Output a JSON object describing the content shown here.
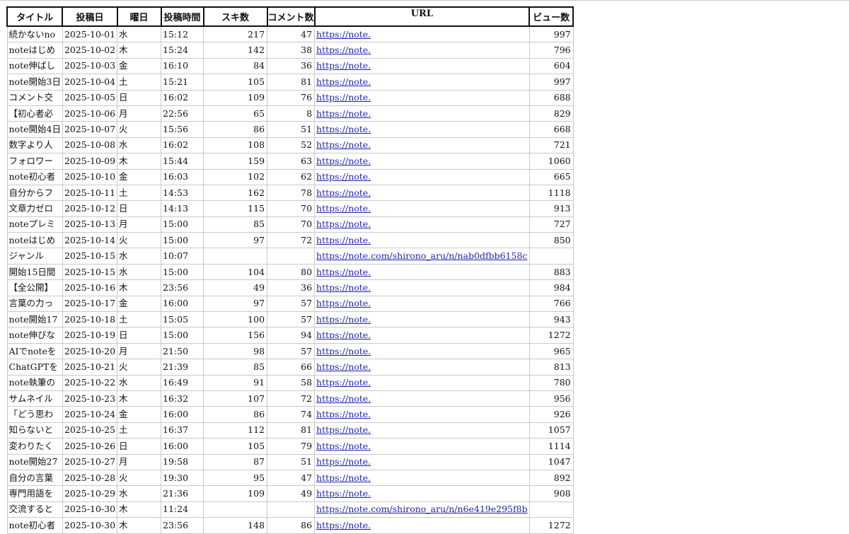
{
  "headers": {
    "title": "タイトル",
    "date": "投稿日",
    "weekday": "曜日",
    "time": "投稿時間",
    "likes": "スキ数",
    "comments": "コメント数",
    "url": "URL",
    "views": "ビュー数"
  },
  "rows": [
    {
      "title": "続かないno",
      "date": "2025-10-01",
      "weekday": "水",
      "time": "15:12",
      "likes": "217",
      "comments": "47",
      "url": "https://note.",
      "views": "997"
    },
    {
      "title": "noteはじめ",
      "date": "2025-10-02",
      "weekday": "木",
      "time": "15:24",
      "likes": "142",
      "comments": "38",
      "url": "https://note.",
      "views": "796"
    },
    {
      "title": "note伸ばし",
      "date": "2025-10-03",
      "weekday": "金",
      "time": "16:10",
      "likes": "84",
      "comments": "36",
      "url": "https://note.",
      "views": "604"
    },
    {
      "title": "note開始3日",
      "date": "2025-10-04",
      "weekday": "土",
      "time": "15:21",
      "likes": "105",
      "comments": "81",
      "url": "https://note.",
      "views": "997"
    },
    {
      "title": "コメント交",
      "date": "2025-10-05",
      "weekday": "日",
      "time": "16:02",
      "likes": "109",
      "comments": "76",
      "url": "https://note.",
      "views": "688"
    },
    {
      "title": "【初心者必",
      "date": "2025-10-06",
      "weekday": "月",
      "time": "22:56",
      "likes": "65",
      "comments": "8",
      "url": "https://note.",
      "views": "829"
    },
    {
      "title": "note開始4日",
      "date": "2025-10-07",
      "weekday": "火",
      "time": "15:56",
      "likes": "86",
      "comments": "51",
      "url": "https://note.",
      "views": "668"
    },
    {
      "title": "数字より人",
      "date": "2025-10-08",
      "weekday": "水",
      "time": "16:02",
      "likes": "108",
      "comments": "52",
      "url": "https://note.",
      "views": "721"
    },
    {
      "title": "フォロワー",
      "date": "2025-10-09",
      "weekday": "木",
      "time": "15:44",
      "likes": "159",
      "comments": "63",
      "url": "https://note.",
      "views": "1060"
    },
    {
      "title": "note初心者",
      "date": "2025-10-10",
      "weekday": "金",
      "time": "16:03",
      "likes": "102",
      "comments": "62",
      "url": "https://note.",
      "views": "665"
    },
    {
      "title": "自分からフ",
      "date": "2025-10-11",
      "weekday": "土",
      "time": "14:53",
      "likes": "162",
      "comments": "78",
      "url": "https://note.",
      "views": "1118"
    },
    {
      "title": "文章力ゼロ",
      "date": "2025-10-12",
      "weekday": "日",
      "time": "14:13",
      "likes": "115",
      "comments": "70",
      "url": "https://note.",
      "views": "913"
    },
    {
      "title": "noteプレミ",
      "date": "2025-10-13",
      "weekday": "月",
      "time": "15:00",
      "likes": "85",
      "comments": "70",
      "url": "https://note.",
      "views": "727"
    },
    {
      "title": "noteはじめ",
      "date": "2025-10-14",
      "weekday": "火",
      "time": "15:00",
      "likes": "97",
      "comments": "72",
      "url": "https://note.",
      "views": "850"
    },
    {
      "title": "ジャンル",
      "date": "2025-10-15",
      "weekday": "水",
      "time": "10:07",
      "likes": "",
      "comments": "",
      "url": "https://note.com/shirono_aru/n/nab0dfbb6158c",
      "views": "",
      "full": true
    },
    {
      "title": "開始15日間",
      "date": "2025-10-15",
      "weekday": "水",
      "time": "15:00",
      "likes": "104",
      "comments": "80",
      "url": "https://note.",
      "views": "883"
    },
    {
      "title": "【全公開】",
      "date": "2025-10-16",
      "weekday": "木",
      "time": "23:56",
      "likes": "49",
      "comments": "36",
      "url": "https://note.",
      "views": "984"
    },
    {
      "title": "言葉の力っ",
      "date": "2025-10-17",
      "weekday": "金",
      "time": "16:00",
      "likes": "97",
      "comments": "57",
      "url": "https://note.",
      "views": "766"
    },
    {
      "title": "note開始17",
      "date": "2025-10-18",
      "weekday": "土",
      "time": "15:05",
      "likes": "100",
      "comments": "57",
      "url": "https://note.",
      "views": "943"
    },
    {
      "title": "note伸びな",
      "date": "2025-10-19",
      "weekday": "日",
      "time": "15:00",
      "likes": "156",
      "comments": "94",
      "url": "https://note.",
      "views": "1272"
    },
    {
      "title": "AIでnoteを",
      "date": "2025-10-20",
      "weekday": "月",
      "time": "21:50",
      "likes": "98",
      "comments": "57",
      "url": "https://note.",
      "views": "965"
    },
    {
      "title": "ChatGPTを",
      "date": "2025-10-21",
      "weekday": "火",
      "time": "21:39",
      "likes": "85",
      "comments": "66",
      "url": "https://note.",
      "views": "813"
    },
    {
      "title": "note執筆の",
      "date": "2025-10-22",
      "weekday": "水",
      "time": "16:49",
      "likes": "91",
      "comments": "58",
      "url": "https://note.",
      "views": "780"
    },
    {
      "title": "サムネイル",
      "date": "2025-10-23",
      "weekday": "木",
      "time": "16:32",
      "likes": "107",
      "comments": "72",
      "url": "https://note.",
      "views": "956"
    },
    {
      "title": "「どう思わ",
      "date": "2025-10-24",
      "weekday": "金",
      "time": "16:00",
      "likes": "86",
      "comments": "74",
      "url": "https://note.",
      "views": "926"
    },
    {
      "title": "知らないと",
      "date": "2025-10-25",
      "weekday": "土",
      "time": "16:37",
      "likes": "112",
      "comments": "81",
      "url": "https://note.",
      "views": "1057"
    },
    {
      "title": "変わりたく",
      "date": "2025-10-26",
      "weekday": "日",
      "time": "16:00",
      "likes": "105",
      "comments": "79",
      "url": "https://note.",
      "views": "1114"
    },
    {
      "title": "note開始27",
      "date": "2025-10-27",
      "weekday": "月",
      "time": "19:58",
      "likes": "87",
      "comments": "51",
      "url": "https://note.",
      "views": "1047"
    },
    {
      "title": "自分の言葉",
      "date": "2025-10-28",
      "weekday": "火",
      "time": "19:30",
      "likes": "95",
      "comments": "47",
      "url": "https://note.",
      "views": "892"
    },
    {
      "title": "専門用語を",
      "date": "2025-10-29",
      "weekday": "水",
      "time": "21:36",
      "likes": "109",
      "comments": "49",
      "url": "https://note.",
      "views": "908"
    },
    {
      "title": "交流すると",
      "date": "2025-10-30",
      "weekday": "木",
      "time": "11:24",
      "likes": "",
      "comments": "",
      "url": "https://note.com/shirono_aru/n/n6e419e295f8b",
      "views": "",
      "full": true
    },
    {
      "title": "note初心者",
      "date": "2025-10-30",
      "weekday": "木",
      "time": "23:56",
      "likes": "148",
      "comments": "86",
      "url": "https://note.",
      "views": "1272"
    }
  ],
  "colors": {
    "link": "#1f1fae",
    "header_border": "#111111",
    "grid": "#c9c9c9"
  }
}
